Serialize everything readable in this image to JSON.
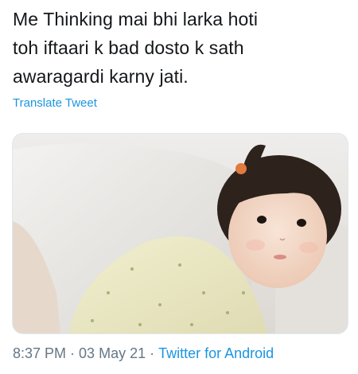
{
  "tweet": {
    "text": "Me Thinking  mai bhi larka hoti\ntoh iftaari k bad dosto k sath\nawaragardi karny jati.",
    "translate_label": "Translate Tweet",
    "time": "8:37 PM",
    "date": "03 May 21",
    "separator": "·",
    "source": "Twitter for Android"
  },
  "colors": {
    "text": "#14171a",
    "link": "#1b95e0",
    "meta": "#657786"
  }
}
